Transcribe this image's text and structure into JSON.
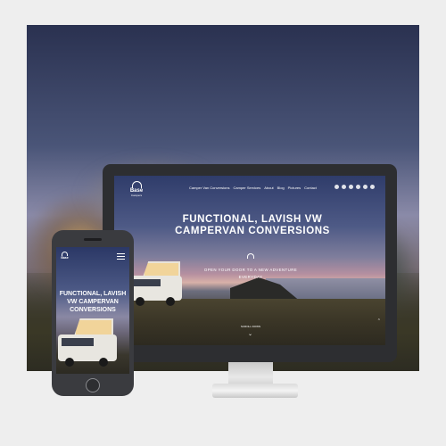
{
  "desktop": {
    "logo": {
      "word": "Base",
      "sub": "Campers"
    },
    "nav": [
      "Camper Van Conversions",
      "Camper Services",
      "About",
      "Blog",
      "Pictures",
      "Contact"
    ],
    "social_icons": [
      "instagram-icon",
      "facebook-icon",
      "twitter-icon",
      "youtube-icon",
      "pinterest-icon",
      "email-icon"
    ],
    "headline": "FUNCTIONAL, LAVISH VW CAMPERVAN CONVERSIONS",
    "tagline": "OPEN YOUR DOOR TO A NEW ADVENTURE EVERYDAY",
    "scroll_label": "SCROLL DOWN",
    "scroll_icon": "chevron-down-icon",
    "back_to_top_icon": "chevron-up-icon"
  },
  "mobile": {
    "logo": {
      "word": "Base"
    },
    "menu_icon": "hamburger-menu-icon",
    "headline": "FUNCTIONAL, LAVISH VW CAMPERVAN CONVERSIONS"
  },
  "colors": {
    "device_frame": "#2d2e31",
    "text": "#ffffff",
    "page_background": "#eeeeee"
  }
}
